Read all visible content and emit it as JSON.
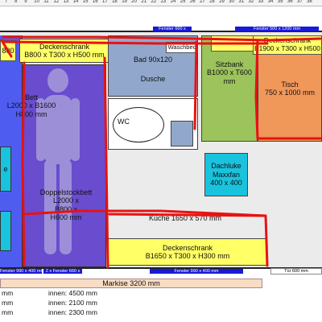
{
  "ruler": {
    "ticks": [
      "7",
      "8",
      "9",
      "10",
      "11",
      "12",
      "13",
      "14",
      "15",
      "16",
      "17",
      "18",
      "19",
      "20",
      "21",
      "22",
      "23",
      "24",
      "25",
      "26",
      "27",
      "28",
      "29",
      "30",
      "31",
      "32",
      "33",
      "34",
      "35",
      "36",
      "37",
      "38"
    ]
  },
  "windows": {
    "top_1": "Fenster 660 x",
    "top_2": "Fenster 500 x 1200 mm",
    "bottom_1": "Fenster 990 x 400 mm",
    "bottom_2": "2 x Fenster 660 x",
    "bottom_3": "Fenster 990 x 400 mm",
    "door": "Tür 600 mm"
  },
  "rooms": {
    "partial_800": "800",
    "deckenschrank_left": "Deckenschrank\nB800 x T300 x H500 mm",
    "bett": "Bett\nL2000 x B1600\nH800 mm",
    "left_partial": "e",
    "doppelstockbett": "Doppelstockbett\nL2000 x\nB800 x\nH600 mm",
    "bad": "Bad 90x120",
    "dusche": "Dusche",
    "waschbecken": "Waschbec",
    "wc": "WC",
    "sitzbank": "Sitzbank\nB1000 x T600\nmm",
    "deckenschrank_right": "Deckenschrank\nB1900 x T300 x H500",
    "tisch": "Tisch\n750 x 1000 mm",
    "dachluke": "Dachluke\nMaxxfan\n400 x 400",
    "kueche": "Küche 1650 x 570 mm",
    "deckenschrank_bottom": "Deckenschrank\nB1650 x T300 x H300 mm",
    "markise": "Markise 3200 mm"
  },
  "dimensions": [
    {
      "left": "mm",
      "right": "innen: 4500 mm"
    },
    {
      "left": "mm",
      "right": "innen: 2100 mm"
    },
    {
      "left": "mm",
      "right": "innen: 2300 mm"
    }
  ]
}
